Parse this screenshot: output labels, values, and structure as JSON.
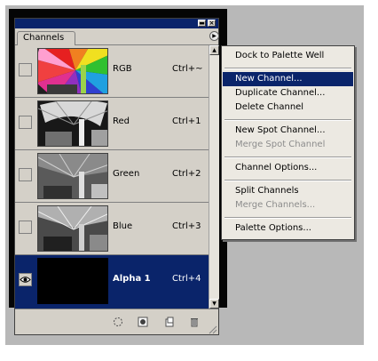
{
  "palette": {
    "tab_label": "Channels",
    "channels": [
      {
        "name": "RGB",
        "shortcut": "Ctrl+~"
      },
      {
        "name": "Red",
        "shortcut": "Ctrl+1"
      },
      {
        "name": "Green",
        "shortcut": "Ctrl+2"
      },
      {
        "name": "Blue",
        "shortcut": "Ctrl+3"
      },
      {
        "name": "Alpha 1",
        "shortcut": "Ctrl+4"
      }
    ]
  },
  "menu": {
    "items": [
      {
        "label": "Dock to Palette Well",
        "enabled": true
      },
      {
        "label": "New Channel...",
        "enabled": true
      },
      {
        "label": "Duplicate Channel...",
        "enabled": true
      },
      {
        "label": "Delete Channel",
        "enabled": true
      },
      {
        "label": "New Spot Channel...",
        "enabled": true
      },
      {
        "label": "Merge Spot Channel",
        "enabled": false
      },
      {
        "label": "Channel Options...",
        "enabled": true
      },
      {
        "label": "Split Channels",
        "enabled": true
      },
      {
        "label": "Merge Channels...",
        "enabled": false
      },
      {
        "label": "Palette Options...",
        "enabled": true
      }
    ]
  }
}
